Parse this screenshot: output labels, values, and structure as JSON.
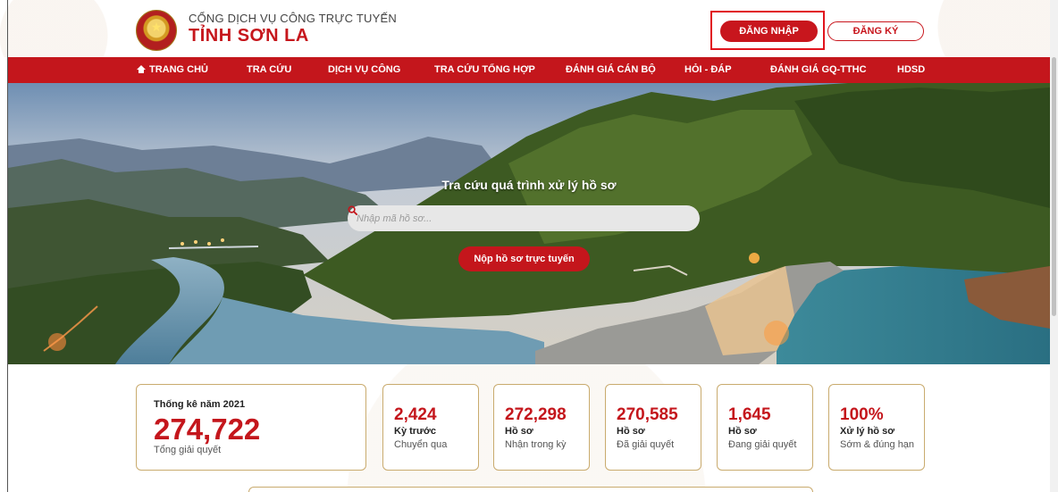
{
  "header": {
    "brand_top": "CỔNG DỊCH VỤ CÔNG TRỰC TUYẾN",
    "brand_main": "TỈNH SƠN LA",
    "login_label": "ĐĂNG NHẬP",
    "register_label": "ĐĂNG KÝ",
    "accent_color": "#c4161c"
  },
  "nav": {
    "items": [
      {
        "label": "TRANG CHỦ",
        "icon": "home-icon"
      },
      {
        "label": "TRA CỨU"
      },
      {
        "label": "DỊCH VỤ CÔNG"
      },
      {
        "label": "TRA CỨU TỔNG HỢP"
      },
      {
        "label": "ĐÁNH GIÁ CÁN BỘ"
      },
      {
        "label": "HỎI - ĐÁP"
      },
      {
        "label": "ĐÁNH GIÁ GQ-TTHC"
      },
      {
        "label": "HDSD"
      }
    ]
  },
  "hero": {
    "title": "Tra cứu quá trình xử lý hồ sơ",
    "search_placeholder": "Nhập mã hồ sơ...",
    "search_value": "",
    "search_icon": "search-icon",
    "submit_label": "Nộp hồ sơ trực tuyến"
  },
  "stats": {
    "main": {
      "label": "Thống kê năm 2021",
      "value": "274,722",
      "sub": "Tổng giải quyết"
    },
    "cards": [
      {
        "value": "2,424",
        "label1": "Kỳ trước",
        "label2": "Chuyển qua"
      },
      {
        "value": "272,298",
        "label1": "Hồ sơ",
        "label2": "Nhận trong kỳ"
      },
      {
        "value": "270,585",
        "label1": "Hồ sơ",
        "label2": "Đã giải quyết"
      },
      {
        "value": "1,645",
        "label1": "Hồ sơ",
        "label2": "Đang giải quyết"
      },
      {
        "value": "100%",
        "label1": "Xử lý hồ sơ",
        "label2": "Sớm & đúng hạn"
      }
    ]
  }
}
